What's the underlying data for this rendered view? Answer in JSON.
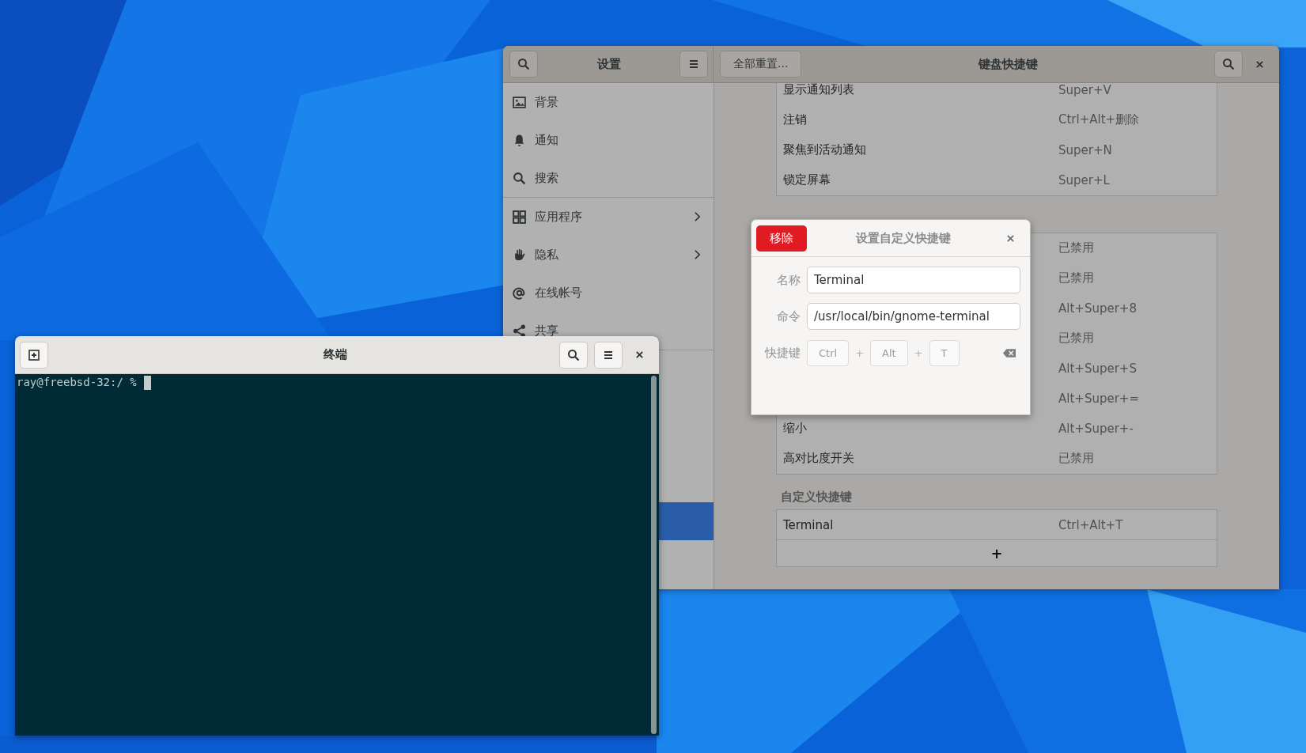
{
  "settings_window": {
    "title": "设置",
    "reset_button": "全部重置...",
    "panel_title": "键盘快捷键",
    "sidebar": {
      "groups": [
        [
          {
            "label": "背景",
            "has_submenu": false,
            "selected": false
          },
          {
            "label": "通知",
            "has_submenu": false,
            "selected": false
          },
          {
            "label": "搜索",
            "has_submenu": false,
            "selected": false
          }
        ],
        [
          {
            "label": "应用程序",
            "has_submenu": true,
            "selected": false
          },
          {
            "label": "隐私",
            "has_submenu": true,
            "selected": false
          },
          {
            "label": "在线帐号",
            "has_submenu": false,
            "selected": false
          },
          {
            "label": "共享",
            "has_submenu": false,
            "selected": false
          }
        ],
        [
          {
            "selected": true
          }
        ]
      ]
    },
    "sections": [
      {
        "rows": [
          {
            "name": "显示通知列表",
            "shortcut": "Super+V"
          },
          {
            "name": "注销",
            "shortcut": "Ctrl+Alt+删除"
          },
          {
            "name": "聚焦到活动通知",
            "shortcut": "Super+N"
          },
          {
            "name": "锁定屏幕",
            "shortcut": "Super+L"
          }
        ]
      },
      {
        "rows": [
          {
            "shortcut": "已禁用"
          },
          {
            "shortcut": "已禁用"
          },
          {
            "shortcut": "Alt+Super+8"
          },
          {
            "shortcut": "已禁用"
          },
          {
            "shortcut": "Alt+Super+S"
          },
          {
            "shortcut": "Alt+Super+="
          },
          {
            "name": "缩小",
            "shortcut": "Alt+Super+-"
          },
          {
            "name": "高对比度开关",
            "shortcut": "已禁用"
          }
        ]
      },
      {
        "title": "自定义快捷键",
        "rows": [
          {
            "name": "Terminal",
            "shortcut": "Ctrl+Alt+T"
          }
        ],
        "add_button": "+"
      }
    ]
  },
  "dialog": {
    "remove_button": "移除",
    "title": "设置自定义快捷键",
    "fields": [
      {
        "label": "名称",
        "value": "Terminal"
      },
      {
        "label": "命令",
        "value": "/usr/local/bin/gnome-terminal"
      }
    ],
    "shortcut": {
      "label": "快捷键",
      "parts": [
        {
          "kind": "key",
          "text": "Ctrl"
        },
        {
          "kind": "plus",
          "text": "+"
        },
        {
          "kind": "key",
          "text": "Alt"
        },
        {
          "kind": "plus",
          "text": "+"
        },
        {
          "kind": "key",
          "text": "T"
        }
      ]
    }
  },
  "terminal": {
    "title": "终端",
    "prompt": "ray@freebsd-32:/ %"
  }
}
